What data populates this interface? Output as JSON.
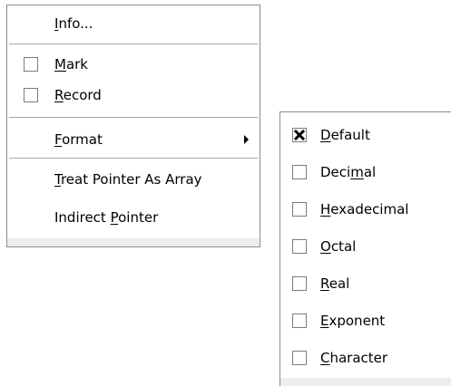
{
  "main_menu": {
    "items": [
      {
        "pre": "",
        "mn": "I",
        "post": "nfo..."
      },
      {
        "pre": "",
        "mn": "M",
        "post": "ark",
        "checked": false
      },
      {
        "pre": "",
        "mn": "R",
        "post": "ecord",
        "checked": false
      },
      {
        "pre": "",
        "mn": "F",
        "post": "ormat",
        "has_submenu": true
      },
      {
        "pre": "",
        "mn": "T",
        "post": "reat Pointer As Array"
      },
      {
        "pre": "Indirect ",
        "mn": "P",
        "post": "ointer"
      }
    ]
  },
  "format_submenu": {
    "items": [
      {
        "pre": "",
        "mn": "D",
        "post": "efault",
        "checked": true
      },
      {
        "pre": "Deci",
        "mn": "m",
        "post": "al",
        "checked": false
      },
      {
        "pre": "",
        "mn": "H",
        "post": "exadecimal",
        "checked": false
      },
      {
        "pre": "",
        "mn": "O",
        "post": "ctal",
        "checked": false
      },
      {
        "pre": "",
        "mn": "R",
        "post": "eal",
        "checked": false
      },
      {
        "pre": "",
        "mn": "E",
        "post": "xponent",
        "checked": false
      },
      {
        "pre": "",
        "mn": "C",
        "post": "haracter",
        "checked": false
      }
    ]
  },
  "colors": {
    "menu_border": "#8c8c8c",
    "separator": "#a8a8a8",
    "bottom_strip": "#ededed",
    "checkbox_border": "#7c7c7c"
  },
  "icons": {
    "submenu_arrow": "triangle-right-icon",
    "checkmark": "x-checkmark-icon"
  }
}
